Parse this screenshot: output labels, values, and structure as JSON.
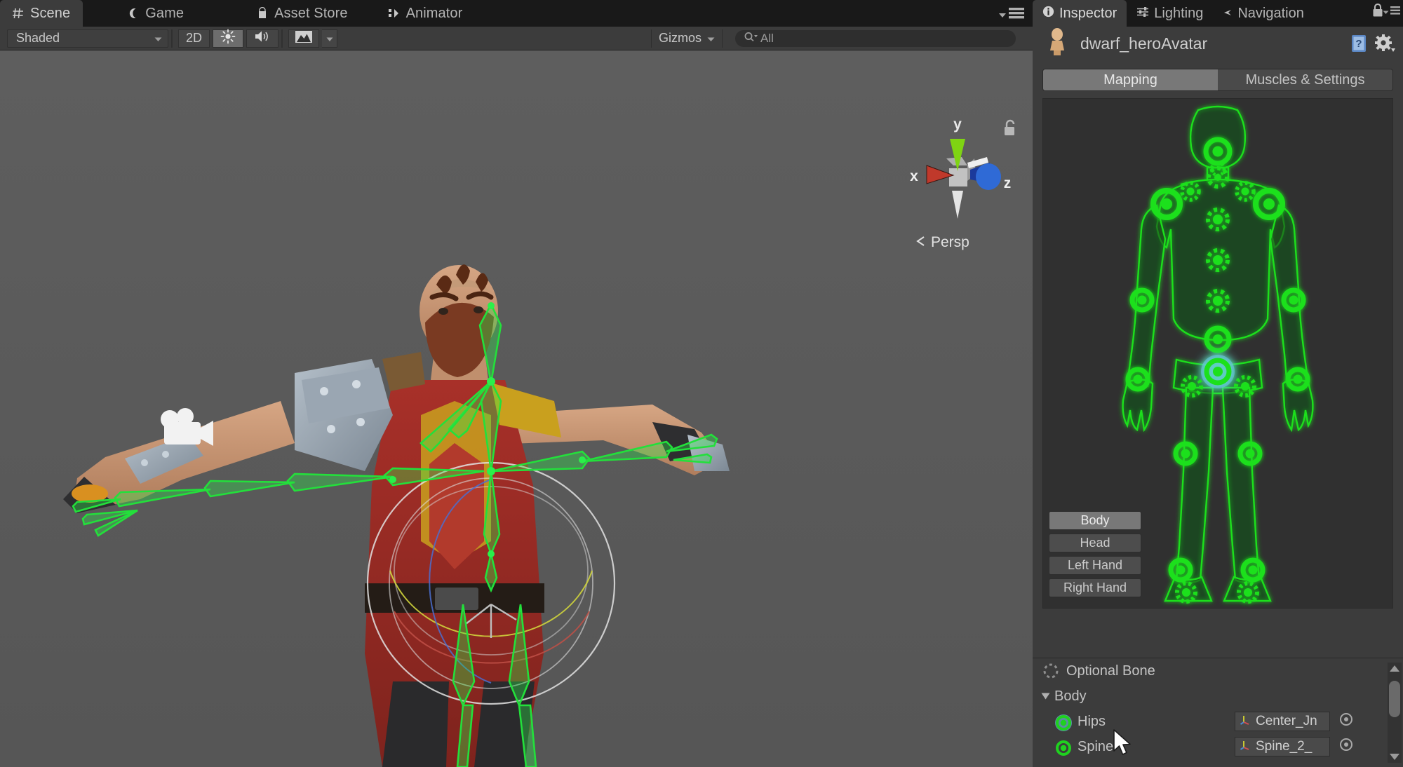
{
  "scene_panel": {
    "tabs": [
      {
        "label": "Scene",
        "icon": "grid-icon",
        "active": true
      },
      {
        "label": "Game",
        "icon": "gamepad-icon",
        "active": false
      },
      {
        "label": "Asset Store",
        "icon": "store-icon",
        "active": false
      },
      {
        "label": "Animator",
        "icon": "animator-icon",
        "active": false
      }
    ],
    "toolbar": {
      "draw_mode": "Shaded",
      "mode_2d": "2D",
      "lighting_toggle": "lighting-icon",
      "audio_toggle": "audio-icon",
      "fx_toggle": "effects-icon",
      "gizmos_label": "Gizmos",
      "search_placeholder": "All",
      "search_value": "All"
    },
    "viewport": {
      "axis_x_label": "x",
      "axis_y_label": "y",
      "axis_z_label": "z",
      "projection_label": "Persp",
      "camera_gizmo": "camera-icon",
      "lock_icon": "unlocked-padlock-icon",
      "colors": {
        "background": "#5a5a5a",
        "bone_green": "#22e03a",
        "axis_x": "#c0392b",
        "axis_y": "#7fd413",
        "axis_z": "#2f5fd0"
      }
    }
  },
  "inspector": {
    "tabs": [
      {
        "label": "Inspector",
        "icon": "info-icon",
        "active": true
      },
      {
        "label": "Lighting",
        "icon": "sliders-icon",
        "active": false
      },
      {
        "label": "Navigation",
        "icon": "nav-icon",
        "active": false
      }
    ],
    "lock_icon": "padlock-icon",
    "menu_icon": "hamburger-icon",
    "title": "dwarf_heroAvatar",
    "avatar_icon": "avatar-mannequin-icon",
    "help_icon": "help-book-icon",
    "settings_icon": "gear-icon",
    "mode_tabs": [
      {
        "label": "Mapping",
        "active": true
      },
      {
        "label": "Muscles & Settings",
        "active": false
      }
    ],
    "body_part_buttons": [
      {
        "label": "Body",
        "active": true
      },
      {
        "label": "Head",
        "active": false
      },
      {
        "label": "Left Hand",
        "active": false
      },
      {
        "label": "Right Hand",
        "active": false
      }
    ],
    "avatar_map": {
      "selected_joint": "hips",
      "selection_color": "#6fc3e8",
      "joint_color": "#1fd11f",
      "body_fill": "#1d4a1d"
    },
    "bone_list": {
      "legend_label": "Optional Bone",
      "legend_icon": "dashed-circle-icon",
      "group_label": "Body",
      "group_expanded": true,
      "rows": [
        {
          "label": "Hips",
          "value": "Center_Jn",
          "state": "selected",
          "picker_icon": "object-picker-icon"
        },
        {
          "label": "Spine",
          "value": "Spine_2_",
          "state": "assigned",
          "picker_icon": "object-picker-icon"
        }
      ],
      "scrollbar": {
        "up_arrow": "triangle-up-icon",
        "down_arrow": "triangle-down-icon"
      }
    }
  },
  "cursor": {
    "icon": "mouse-pointer-icon"
  }
}
